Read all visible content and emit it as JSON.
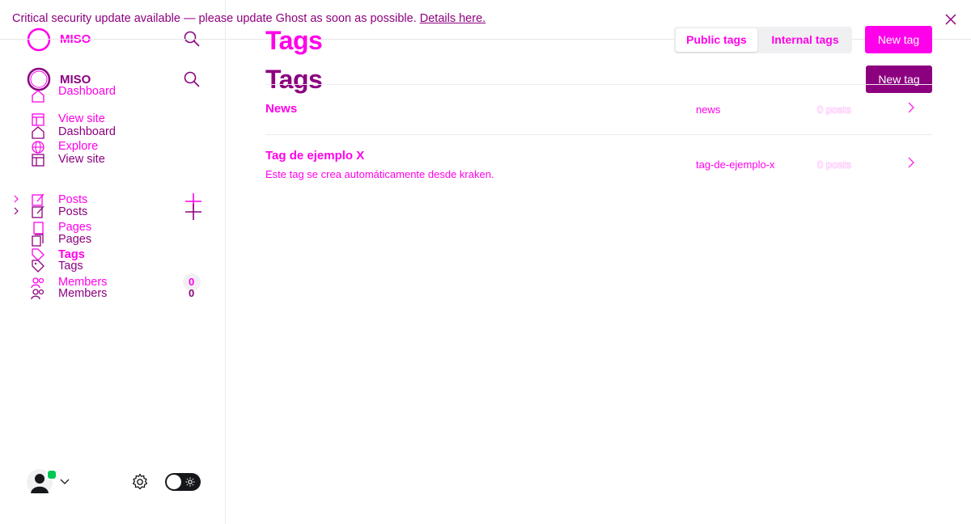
{
  "banner": {
    "message": "Critical security update available — please update Ghost as soon as possible.",
    "link_label": "Details here."
  },
  "sidebar": {
    "site_name": "MISO",
    "site_name_2": "MISO",
    "nav_top": [
      "Dashboard",
      "View site",
      "Dashboard",
      "Explore",
      "View site"
    ],
    "nav_content": {
      "posts_1": "Posts",
      "posts_2": "Posts",
      "pages_1": "Pages",
      "pages_2": "Pages",
      "tags_1": "Tags",
      "tags_2": "Tags",
      "members_1": "Members",
      "members_2": "Members",
      "members_count_1": "0",
      "members_count_2": "0"
    },
    "status_color": "#00c853"
  },
  "page": {
    "title": "Tags",
    "title_2": "Tags",
    "tab_public": "Public tags",
    "tab_internal": "Internal tags",
    "new_tag": "New tag",
    "new_tag_2": "New tag"
  },
  "tags": [
    {
      "name": "News",
      "description": "",
      "slug": "news",
      "count": "0 posts"
    },
    {
      "name": "Tag de ejemplo X",
      "description": "Este tag se crea automáticamente desde kraken.",
      "slug": "tag-de-ejemplo-x",
      "count": "0 posts"
    }
  ],
  "colors": {
    "accent": "#ff00ea",
    "accent_dark": "#8c007f"
  }
}
